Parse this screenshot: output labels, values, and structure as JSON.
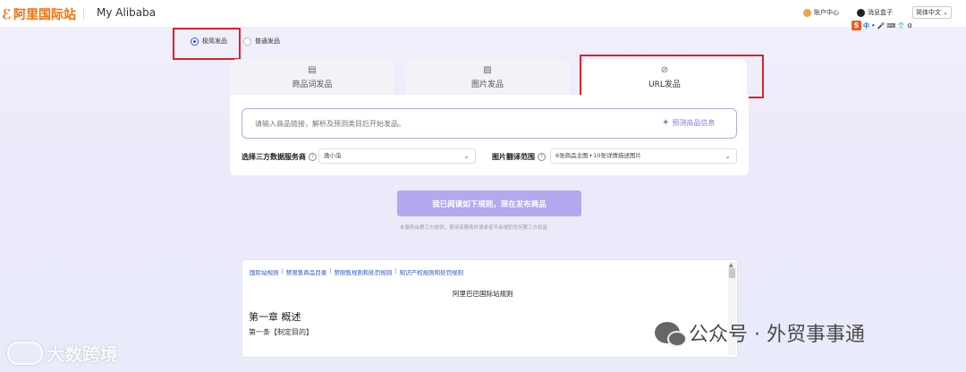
{
  "header": {
    "logo_text": "阿里国际站",
    "site_name": "My Alibaba",
    "account_center": "账户中心",
    "message_box": "消息盒子",
    "language": "简体中文",
    "ime_toolbar": [
      "中",
      "•",
      "🎤",
      "⌨",
      "👕",
      "⚙"
    ]
  },
  "publish_mode": {
    "options": [
      {
        "label": "极简发品",
        "selected": true
      },
      {
        "label": "普通发品",
        "selected": false
      }
    ]
  },
  "tabs": [
    {
      "label": "商品词发品",
      "icon": "document-icon",
      "active": false
    },
    {
      "label": "图片发品",
      "icon": "image-icon",
      "active": false
    },
    {
      "label": "URL发品",
      "icon": "link-icon",
      "active": true
    }
  ],
  "url_input": {
    "placeholder": "请输入商品链接，解析及预测类目后开始发品。",
    "predict_button": "预测商品信息"
  },
  "third_party": {
    "label": "选择三方数据服务商",
    "value": "逸小虫"
  },
  "image_translation": {
    "label": "图片翻译范围",
    "value": "6张商品主图+10张详情描述图片"
  },
  "publish_button": "我已阅读如下规则，现在发布商品",
  "publish_note": "本服务由第三方提供，使用该服务时请承诺不会侵犯任何第三方权益",
  "rules": {
    "links": [
      "国际站规则",
      "禁限售商品目录",
      "禁限售规则和处罚规则",
      "知识产权规则和处罚规则"
    ],
    "title": "阿里巴巴国际站规则",
    "chapter": "第一章 概述",
    "article": "第一条【制定目的】"
  },
  "watermarks": {
    "left": "大数跨境",
    "right": "公众号 · 外贸事事通"
  },
  "colors": {
    "brand": "#ff6a00",
    "accent": "#b4a8ee",
    "highlight": "#d9232e",
    "link": "#2a55c9"
  }
}
